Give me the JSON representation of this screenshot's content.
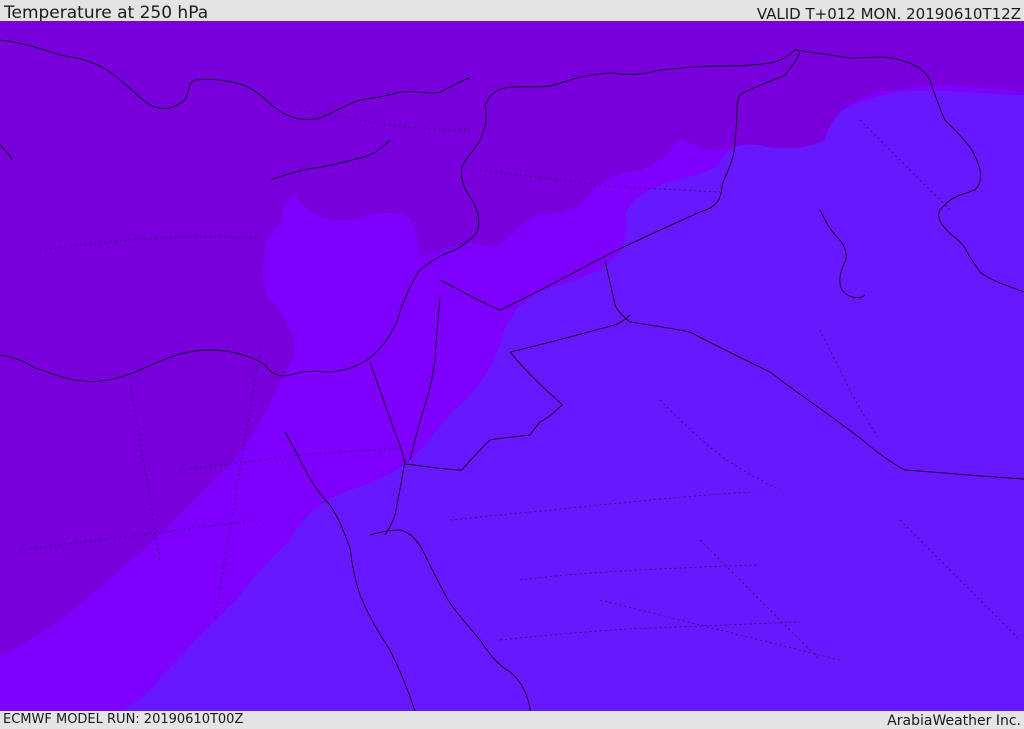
{
  "header": {
    "title": "Temperature at 250 hPa",
    "valid_time": "VALID T+012 MON. 20190610T12Z"
  },
  "footer": {
    "model_run": "ECMWF MODEL RUN: 20190610T00Z",
    "credit": "ArabiaWeather Inc."
  },
  "map": {
    "colors": {
      "zone_cold": "#7800dc",
      "zone_mid": "#7e00fe",
      "zone_warm": "#6818fe",
      "coastline": "#1a0033",
      "border": "#220033"
    }
  }
}
